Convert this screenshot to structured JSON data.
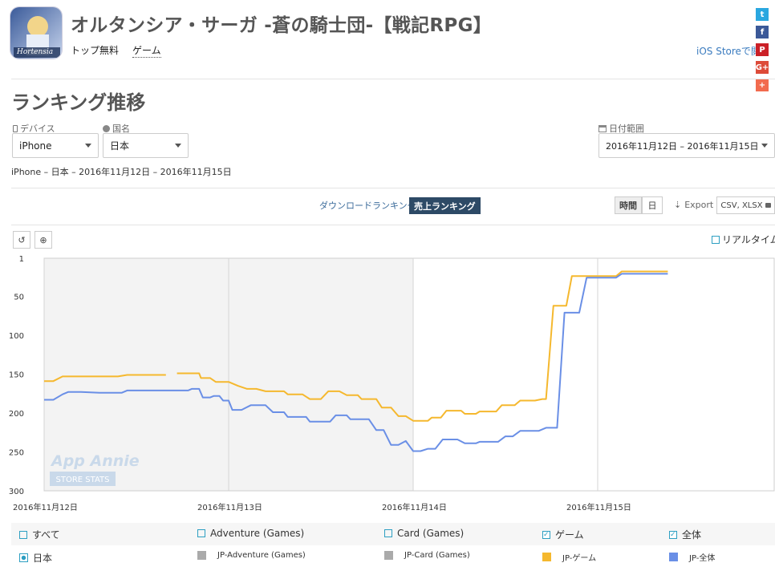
{
  "app": {
    "title": "オルタンシア・サーガ -蒼の騎士団-【戦記RPG】",
    "category1": "トップ無料",
    "category2": "ゲーム",
    "store_link": "iOS Storeで閲",
    "icon_text": "Hortensia"
  },
  "share": [
    {
      "name": "twitter-share-icon",
      "color": "#2aa7e0",
      "glyph": "t"
    },
    {
      "name": "facebook-share-icon",
      "color": "#3b5998",
      "glyph": "f"
    },
    {
      "name": "pinterest-share-icon",
      "color": "#cb2027",
      "glyph": "P"
    },
    {
      "name": "googleplus-share-icon",
      "color": "#dd4b39",
      "glyph": "G+"
    },
    {
      "name": "more-share-icon",
      "color": "#f26b4e",
      "glyph": "+"
    }
  ],
  "section": {
    "title": "ランキング推移"
  },
  "filters": {
    "device_label": "デバイス",
    "device_value": "iPhone",
    "country_label": "国名",
    "country_value": "日本",
    "date_label": "日付範囲",
    "date_value": "2016年11月12日 – 2016年11月15日"
  },
  "summary": "iPhone – 日本 – 2016年11月12日 – 2016年11月15日",
  "toolbar": {
    "download_ranking": "ダウンロードランキング",
    "sales_ranking": "売上ランキング",
    "hour": "時間",
    "day": "日",
    "export": "Export",
    "csv": "CSV, XLSX",
    "realtime": "リアルタイム"
  },
  "watermark": {
    "brand": "App Annie",
    "sub": "STORE STATS"
  },
  "colors": {
    "game": "#f5b82e",
    "overall": "#6a8fe6",
    "accent": "#2d4a66"
  },
  "chart_data": {
    "type": "line",
    "y_inverted": true,
    "ylim": [
      1,
      300
    ],
    "y_ticks": [
      "1",
      "50",
      "100",
      "150",
      "200",
      "250",
      "300"
    ],
    "x_ticks": [
      "2016年11月12日",
      "2016年11月13日",
      "2016年11月14日",
      "2016年11月15日"
    ],
    "x_unit": "days since 2016年11月12日 00:00",
    "series": [
      {
        "name": "JP-ゲーム",
        "color": "#f5b82e",
        "points": [
          [
            0,
            159
          ],
          [
            0.05,
            159
          ],
          [
            0.1,
            153
          ],
          [
            0.3,
            153
          ],
          [
            0.4,
            153
          ],
          [
            0.45,
            151
          ],
          [
            0.6,
            151
          ],
          [
            0.66,
            151
          ],
          [
            0.68,
            null
          ],
          [
            0.72,
            149
          ],
          [
            0.8,
            149
          ],
          [
            0.84,
            149
          ],
          [
            0.85,
            155
          ],
          [
            0.9,
            155
          ],
          [
            0.93,
            160
          ],
          [
            1.0,
            160
          ],
          [
            1.05,
            165
          ],
          [
            1.1,
            169
          ],
          [
            1.12,
            169
          ],
          [
            1.15,
            169
          ],
          [
            1.2,
            172
          ],
          [
            1.3,
            172
          ],
          [
            1.32,
            176
          ],
          [
            1.4,
            176
          ],
          [
            1.44,
            182
          ],
          [
            1.5,
            182
          ],
          [
            1.54,
            172
          ],
          [
            1.6,
            172
          ],
          [
            1.64,
            177
          ],
          [
            1.7,
            177
          ],
          [
            1.72,
            182
          ],
          [
            1.8,
            182
          ],
          [
            1.83,
            193
          ],
          [
            1.88,
            193
          ],
          [
            1.92,
            204
          ],
          [
            1.96,
            204
          ],
          [
            2.0,
            210
          ],
          [
            2.08,
            210
          ],
          [
            2.1,
            206
          ],
          [
            2.15,
            206
          ],
          [
            2.18,
            197
          ],
          [
            2.26,
            197
          ],
          [
            2.28,
            201
          ],
          [
            2.34,
            201
          ],
          [
            2.36,
            198
          ],
          [
            2.45,
            198
          ],
          [
            2.48,
            190
          ],
          [
            2.55,
            190
          ],
          [
            2.58,
            184
          ],
          [
            2.66,
            184
          ],
          [
            2.7,
            182
          ],
          [
            2.72,
            182
          ],
          [
            2.76,
            62
          ],
          [
            2.83,
            62
          ],
          [
            2.86,
            24
          ],
          [
            2.94,
            24
          ],
          [
            3.0,
            24
          ],
          [
            3.1,
            24
          ],
          [
            3.13,
            18
          ],
          [
            3.3,
            18
          ],
          [
            3.38,
            18
          ]
        ]
      },
      {
        "name": "JP-全体",
        "color": "#6a8fe6",
        "points": [
          [
            0,
            183
          ],
          [
            0.05,
            183
          ],
          [
            0.1,
            176
          ],
          [
            0.13,
            173
          ],
          [
            0.2,
            173
          ],
          [
            0.3,
            174
          ],
          [
            0.4,
            174
          ],
          [
            0.42,
            174
          ],
          [
            0.45,
            171
          ],
          [
            0.6,
            171
          ],
          [
            0.7,
            171
          ],
          [
            0.78,
            171
          ],
          [
            0.8,
            169
          ],
          [
            0.84,
            169
          ],
          [
            0.86,
            180
          ],
          [
            0.9,
            180
          ],
          [
            0.92,
            178
          ],
          [
            0.95,
            178
          ],
          [
            0.97,
            184
          ],
          [
            1.0,
            184
          ],
          [
            1.02,
            196
          ],
          [
            1.07,
            196
          ],
          [
            1.12,
            190
          ],
          [
            1.2,
            190
          ],
          [
            1.24,
            199
          ],
          [
            1.3,
            199
          ],
          [
            1.32,
            205
          ],
          [
            1.42,
            205
          ],
          [
            1.44,
            211
          ],
          [
            1.55,
            211
          ],
          [
            1.58,
            203
          ],
          [
            1.64,
            203
          ],
          [
            1.66,
            208
          ],
          [
            1.76,
            208
          ],
          [
            1.8,
            222
          ],
          [
            1.84,
            222
          ],
          [
            1.88,
            241
          ],
          [
            1.92,
            241
          ],
          [
            1.96,
            236
          ],
          [
            2.0,
            249
          ],
          [
            2.04,
            249
          ],
          [
            2.08,
            246
          ],
          [
            2.12,
            246
          ],
          [
            2.16,
            234
          ],
          [
            2.22,
            234
          ],
          [
            2.24,
            234
          ],
          [
            2.28,
            239
          ],
          [
            2.34,
            239
          ],
          [
            2.36,
            237
          ],
          [
            2.46,
            237
          ],
          [
            2.5,
            230
          ],
          [
            2.54,
            230
          ],
          [
            2.58,
            223
          ],
          [
            2.68,
            223
          ],
          [
            2.72,
            219
          ],
          [
            2.78,
            219
          ],
          [
            2.82,
            71
          ],
          [
            2.9,
            71
          ],
          [
            2.94,
            26
          ],
          [
            3.0,
            26
          ],
          [
            3.1,
            26
          ],
          [
            3.13,
            21
          ],
          [
            3.3,
            21
          ],
          [
            3.38,
            21
          ]
        ]
      }
    ],
    "legend_filters": [
      {
        "label": "すべて",
        "checked": false
      },
      {
        "label": "Adventure (Games)",
        "checked": false
      },
      {
        "label": "Card (Games)",
        "checked": false
      },
      {
        "label": "ゲーム",
        "checked": true
      },
      {
        "label": "全体",
        "checked": true
      }
    ],
    "legend_series": [
      {
        "label": "日本",
        "color": "#2d9fc2",
        "radio": true
      },
      {
        "label": "JP-Adventure (Games)",
        "color": "#aaaaaa"
      },
      {
        "label": "JP-Card (Games)",
        "color": "#aaaaaa"
      },
      {
        "label": "JP-ゲーム",
        "color": "#f5b82e"
      },
      {
        "label": "JP-全体",
        "color": "#6a8fe6"
      }
    ]
  }
}
